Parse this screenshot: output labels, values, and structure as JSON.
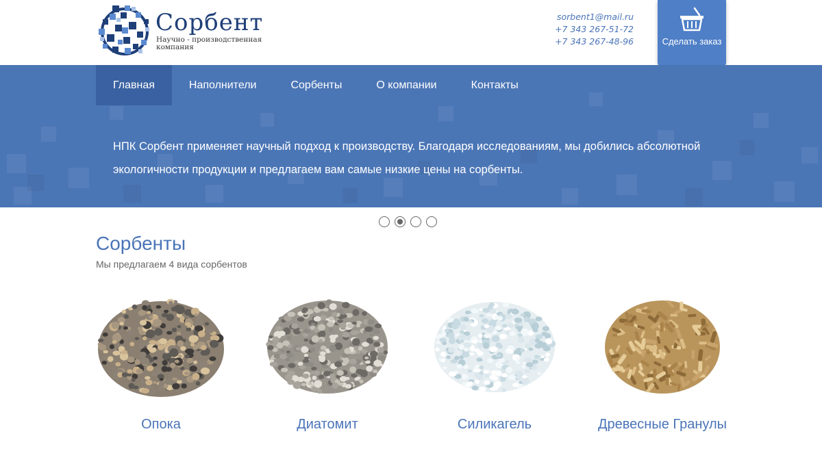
{
  "header": {
    "logo": {
      "title": "Сорбент",
      "subtitle": "Научно - производственная компания"
    },
    "contacts": {
      "email": "sorbent1@mail.ru",
      "phone1": "+7 343 267-51-72",
      "phone2": "+7 343 267-48-96"
    },
    "order_button": {
      "label": "Сделать заказ",
      "icon": "basket-icon"
    }
  },
  "nav": {
    "items": [
      {
        "label": "Главная",
        "active": true
      },
      {
        "label": "Наполнители",
        "active": false
      },
      {
        "label": "Сорбенты",
        "active": false
      },
      {
        "label": "О компании",
        "active": false
      },
      {
        "label": "Контакты",
        "active": false
      }
    ]
  },
  "banner": {
    "text": "НПК Сорбент применяет научный подход к производству. Благодаря исследованиям, мы добились абсолютной экологичности продукции и предлагаем вам самые низкие цены на сорбенты.",
    "slides_total": 4,
    "slide_active_index": 1
  },
  "section": {
    "title": "Сорбенты",
    "subtitle": "Мы предлагаем 4 вида сорбентов"
  },
  "products": [
    {
      "name": "Опока"
    },
    {
      "name": "Диатомит"
    },
    {
      "name": "Силикагель"
    },
    {
      "name": "Древесные Гранулы"
    }
  ],
  "colors": {
    "accent": "#4b76b6",
    "nav_active": "#3a62a2",
    "link": "#4a74b8",
    "logo_dark": "#1f3f78"
  }
}
